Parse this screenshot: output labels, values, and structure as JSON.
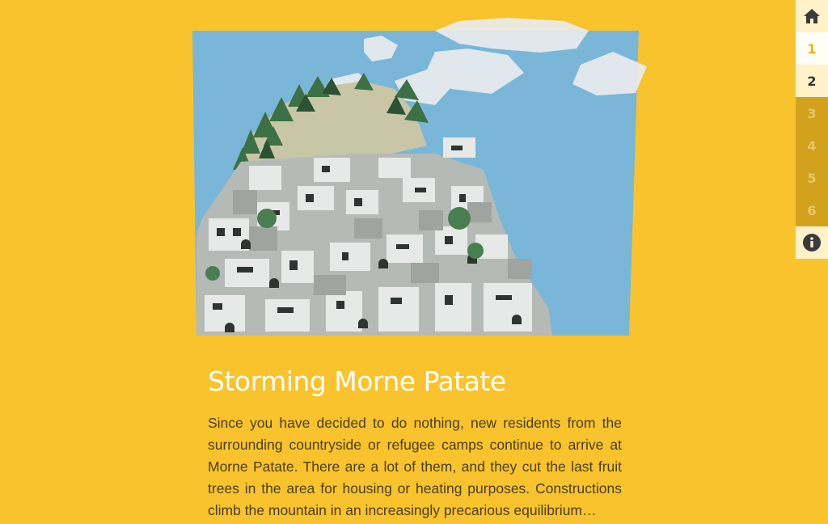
{
  "article": {
    "title": "Storming Morne Patate",
    "body": "Since you have decided to do nothing, new residents from the surrounding countryside or refugee camps continue to arrive at Morne Patate. There are a lot of them, and they cut the last fruit trees in the area for housing or heating purposes. Constructions climb the mountain in an increasingly precarious equilibrium…"
  },
  "nav": {
    "home_icon": "home-icon",
    "items": [
      {
        "label": "1",
        "state": "active"
      },
      {
        "label": "2",
        "state": "visited"
      },
      {
        "label": "3",
        "state": "locked"
      },
      {
        "label": "4",
        "state": "locked"
      },
      {
        "label": "5",
        "state": "locked"
      },
      {
        "label": "6",
        "state": "locked"
      }
    ],
    "info_icon": "info-icon"
  },
  "colors": {
    "background": "#f9c32e",
    "sky": "#7ab6d7",
    "title": "#ffffff",
    "body_text": "#4a3f1c"
  }
}
